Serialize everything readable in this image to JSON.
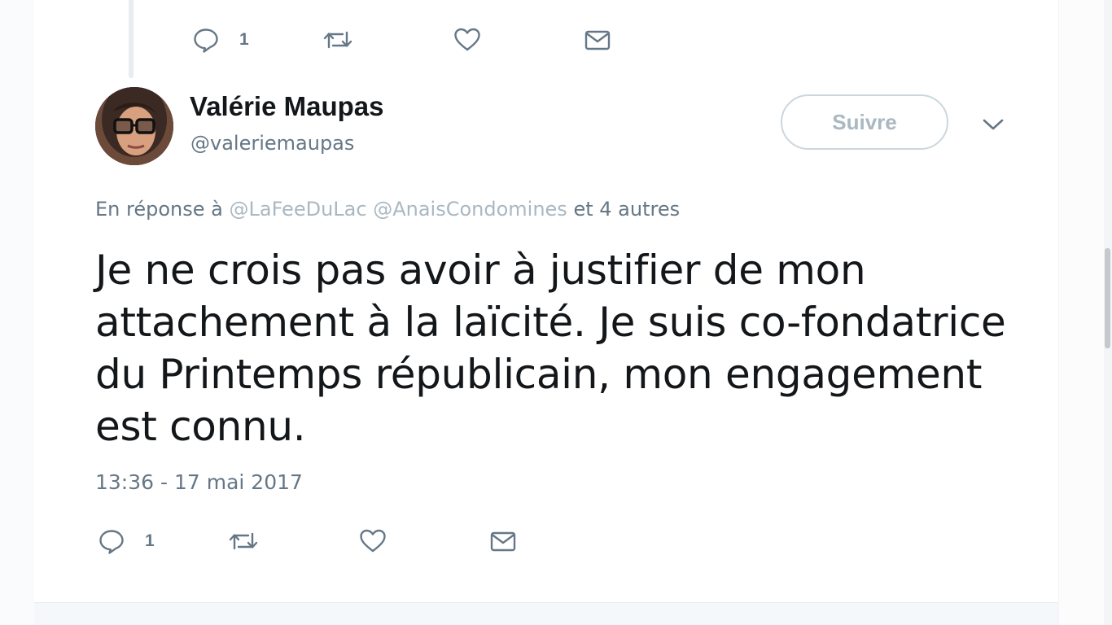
{
  "previous_tweet": {
    "actions": {
      "reply_count": "1"
    }
  },
  "tweet": {
    "author": {
      "display_name": "Valérie Maupas",
      "handle": "@valeriemaupas"
    },
    "follow_label": "Suivre",
    "reply_context": {
      "prefix": "En réponse à",
      "mentions": [
        "@LaFeeDuLac",
        "@AnaisCondomines"
      ],
      "suffix": "et 4 autres"
    },
    "text": "Je ne crois pas avoir à justifier de mon attachement à la laïcité. Je suis co-fondatrice du Printemps républicain, mon engagement est connu.",
    "timestamp": "13:36 - 17 mai 2017",
    "actions": {
      "reply_count": "1"
    }
  },
  "icons": {
    "reply": "reply-bubble-icon",
    "retweet": "retweet-icon",
    "like": "heart-icon",
    "dm": "envelope-icon",
    "caret": "chevron-down-icon"
  },
  "colors": {
    "text": "#14171a",
    "secondary": "#657786",
    "muted": "#aab8c2",
    "border": "#ccd6dd"
  }
}
